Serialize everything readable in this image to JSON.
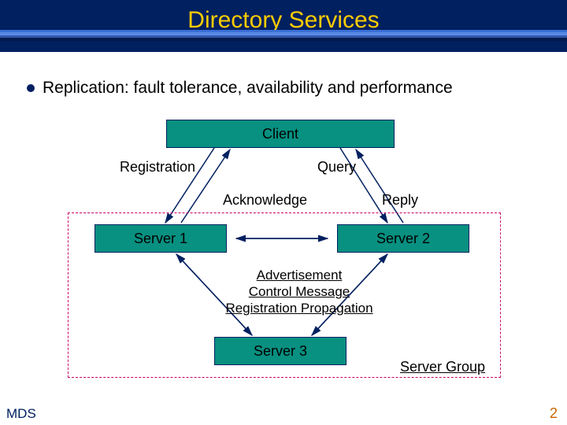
{
  "title": "Directory Services",
  "bullet": "Replication: fault tolerance, availability and performance",
  "boxes": {
    "client": "Client",
    "server1": "Server 1",
    "server2": "Server 2",
    "server3": "Server 3"
  },
  "labels": {
    "registration": "Registration",
    "query": "Query",
    "acknowledge": "Acknowledge",
    "reply": "Reply",
    "server_group": "Server Group"
  },
  "messages": {
    "line1": "Advertisement",
    "line2": "Control Message",
    "line3": "Registration Propagation"
  },
  "footer": {
    "left": "MDS",
    "right": "2"
  },
  "colors": {
    "header_bg": "#002060",
    "title_fg": "#FFCC00",
    "box_fill": "#089080",
    "group_border": "#cc0066",
    "arrow": "#002060"
  }
}
